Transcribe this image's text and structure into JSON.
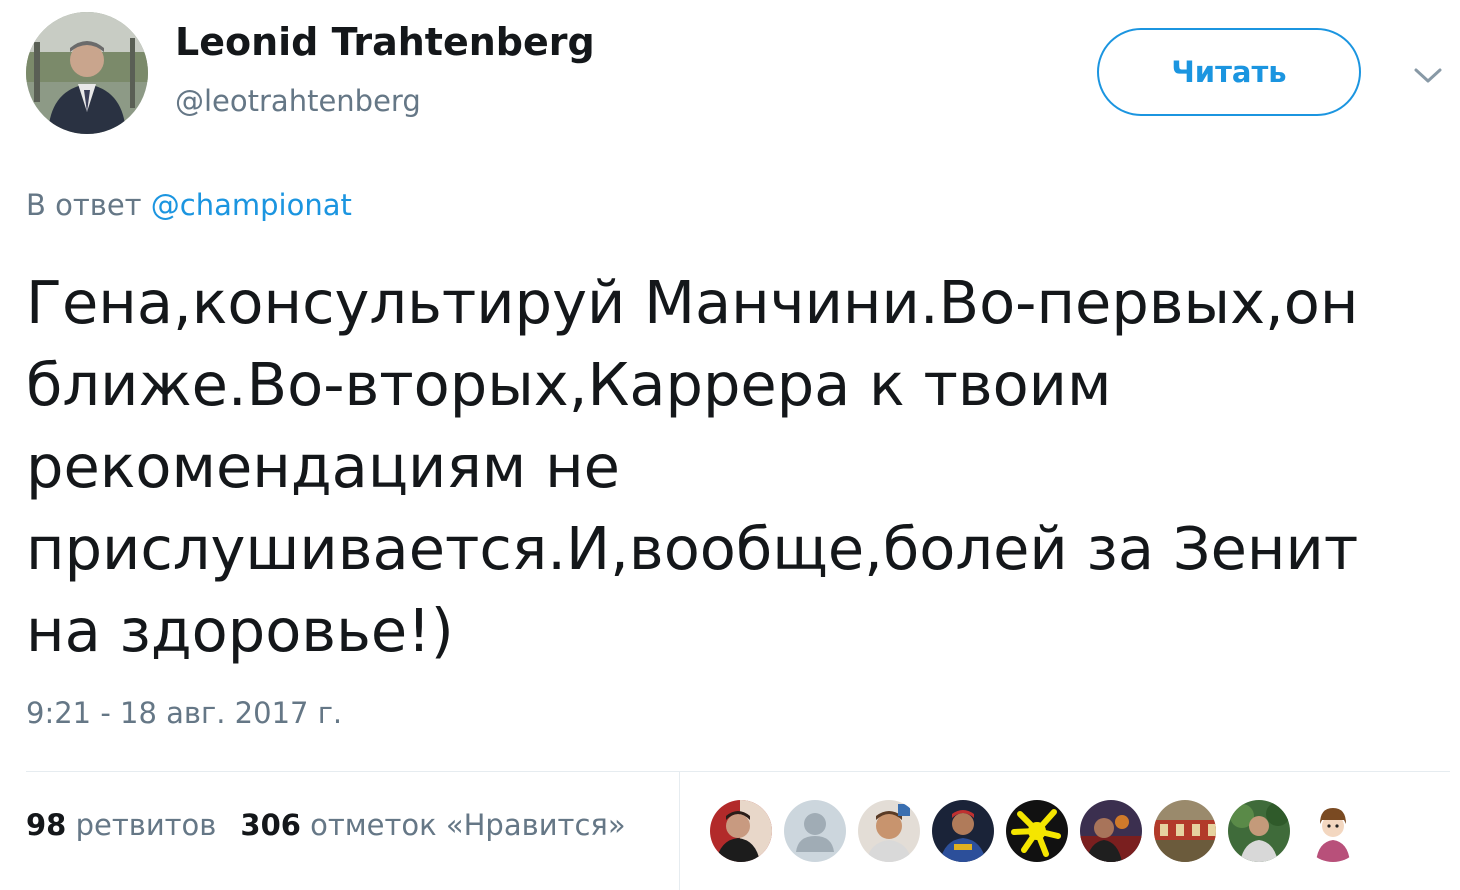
{
  "author": {
    "display_name": "Leonid Trahtenberg",
    "handle": "@leotrahtenberg",
    "avatar_icon": "user-photo-icon"
  },
  "follow_button": {
    "label": "Читать",
    "color": "#1b95e0"
  },
  "menu": {
    "icon": "chevron-down-icon"
  },
  "reply": {
    "prefix": "В ответ",
    "mention": "@championat"
  },
  "tweet": {
    "text": "Гена,консультируй Манчини.Во-первых,он\nближе.Во-вторых,Каррера к твоим\nрекомендациям не\nприслушивается.И,вообще,болей за Зенит\nна здоровье!)",
    "timestamp": "9:21 - 18 авг. 2017 г."
  },
  "stats": {
    "retweets_count": "98",
    "retweets_label": "ретвитов",
    "likes_count": "306",
    "likes_label": "отметок «Нравится»"
  },
  "likers": [
    {
      "icon": "user-avatar-icon"
    },
    {
      "icon": "default-avatar-icon"
    },
    {
      "icon": "user-avatar-icon"
    },
    {
      "icon": "user-avatar-icon"
    },
    {
      "icon": "user-avatar-icon"
    },
    {
      "icon": "user-avatar-icon"
    },
    {
      "icon": "user-avatar-icon"
    },
    {
      "icon": "user-avatar-icon"
    },
    {
      "icon": "cartoon-avatar-icon"
    }
  ],
  "colors": {
    "text_primary": "#14171a",
    "text_secondary": "#657786",
    "link": "#1b95e0",
    "divider": "#e6ecf0"
  }
}
